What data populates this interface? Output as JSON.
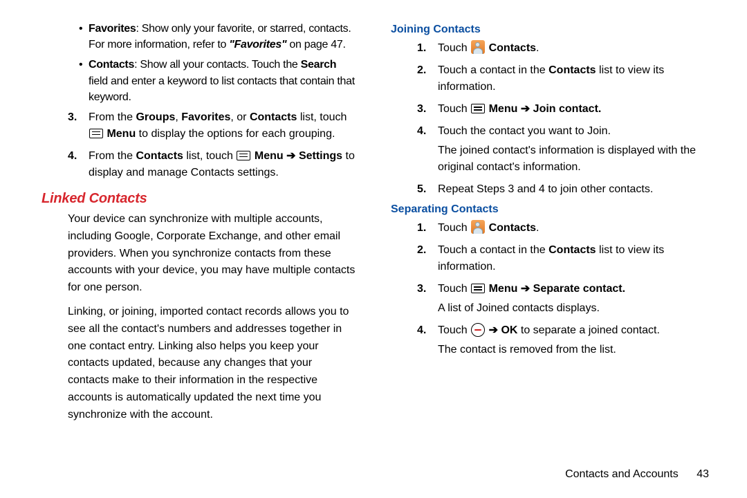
{
  "left": {
    "bullets": [
      {
        "label": "Favorites",
        "desc": ": Show only your favorite, or starred, contacts. For more information, refer to ",
        "ref": "\"Favorites\"",
        "ref_tail": " on page 47."
      },
      {
        "label": "Contacts",
        "desc": ": Show all your contacts. Touch the ",
        "bold2": "Search",
        "desc2": " field and enter a keyword to list contacts that contain that keyword."
      }
    ],
    "step3_a": "From the ",
    "step3_b": "Groups",
    "step3_c": ", ",
    "step3_d": "Favorites",
    "step3_e": ", or ",
    "step3_f": "Contacts",
    "step3_g": " list, touch ",
    "step3_menu": "Menu",
    "step3_h": " to display the options for each grouping.",
    "step4_a": "From the ",
    "step4_b": "Contacts",
    "step4_c": " list, touch ",
    "step4_menu": "Menu",
    "step4_arrow": " ➔ ",
    "step4_settings": "Settings",
    "step4_d": " to display and manage Contacts settings.",
    "linked_title": "Linked Contacts",
    "linked_p1": "Your device can synchronize with multiple accounts, including Google, Corporate Exchange, and other email providers. When you synchronize contacts from these accounts with your device, you may have multiple contacts for one person.",
    "linked_p2": "Linking, or joining, imported contact records allows you to see all the contact's numbers and addresses together in one contact entry. Linking also helps you keep your contacts updated, because any changes that your contacts make to their information in the respective accounts is automatically updated the next time you synchronize with the account."
  },
  "right": {
    "join_title": "Joining Contacts",
    "j1_a": "Touch ",
    "j1_b": "Contacts",
    "j1_c": ".",
    "j2_a": "Touch a contact in the ",
    "j2_b": "Contacts",
    "j2_c": " list to view its information.",
    "j3_a": "Touch ",
    "j3_menu": "Menu",
    "j3_arrow": " ➔ ",
    "j3_b": "Join contact.",
    "j4_a": "Touch the contact you want to Join.",
    "j4_b": "The joined contact's information is displayed with the original contact's information.",
    "j5": "Repeat Steps 3 and 4 to join other contacts.",
    "sep_title": "Separating Contacts",
    "s1_a": "Touch ",
    "s1_b": "Contacts",
    "s1_c": ".",
    "s2_a": "Touch a contact in the ",
    "s2_b": "Contacts",
    "s2_c": " list to view its information.",
    "s3_a": "Touch ",
    "s3_menu": "Menu",
    "s3_arrow": " ➔ ",
    "s3_b": "Separate contact.",
    "s3_c": "A list of Joined contacts displays.",
    "s4_a": "Touch ",
    "s4_arrow": " ➔ ",
    "s4_b": "OK",
    "s4_c": " to separate a joined contact.",
    "s4_d": "The contact is removed from the list."
  },
  "footer": {
    "section": "Contacts and Accounts",
    "page": "43"
  }
}
